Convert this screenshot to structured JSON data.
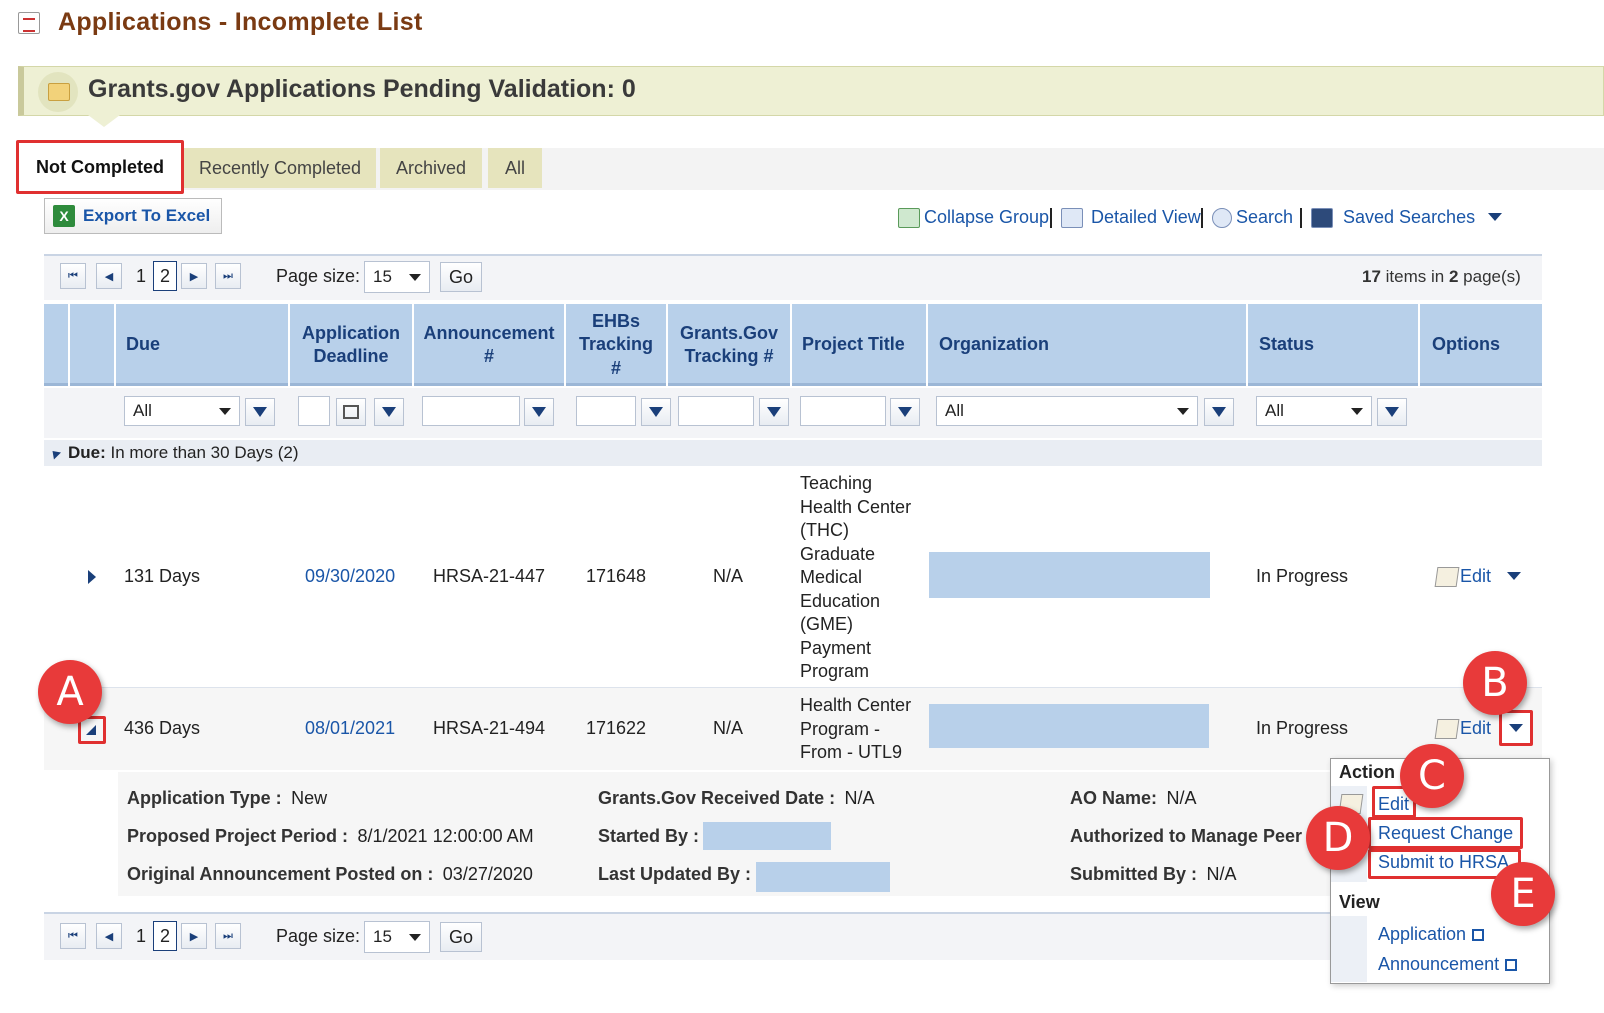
{
  "page": {
    "title": "Applications - Incomplete List",
    "banner": "Grants.gov Applications Pending Validation: 0"
  },
  "tabs": [
    {
      "label": "Not Completed",
      "active": true
    },
    {
      "label": "Recently Completed"
    },
    {
      "label": "Archived"
    },
    {
      "label": "All"
    }
  ],
  "toolbar": {
    "export": "Export To Excel",
    "collapse": "Collapse Group",
    "detailed": "Detailed View",
    "search": "Search",
    "saved": "Saved Searches"
  },
  "pager": {
    "page1": "1",
    "page2": "2",
    "page_size_label": "Page size:",
    "page_size": "15",
    "go": "Go",
    "items_count": "17",
    "items_text1": "items in",
    "pages_count": "2",
    "items_text2": "page(s)"
  },
  "columns": {
    "due": "Due",
    "deadline1": "Application",
    "deadline2": "Deadline",
    "announcement1": "Announcement",
    "announcement2": "#",
    "ehbs1": "EHBs",
    "ehbs2": "Tracking",
    "ehbs3": "#",
    "grants1": "Grants.Gov",
    "grants2": "Tracking #",
    "project": "Project Title",
    "organization": "Organization",
    "status": "Status",
    "options": "Options"
  },
  "filters": {
    "due": "All",
    "organization": "All",
    "status": "All"
  },
  "group": {
    "label": "Due:",
    "value": "In more than 30 Days (2)"
  },
  "rows": [
    {
      "due": "131 Days",
      "deadline": "09/30/2020",
      "announcement": "HRSA-21-447",
      "ehbs": "171648",
      "grants": "N/A",
      "project_lines": [
        "Teaching",
        "Health Center",
        "(THC)",
        "Graduate",
        "Medical",
        "Education",
        "(GME)",
        "Payment",
        "Program"
      ],
      "status": "In Progress",
      "edit": "Edit"
    },
    {
      "due": "436 Days",
      "deadline": "08/01/2021",
      "announcement": "HRSA-21-494",
      "ehbs": "171622",
      "grants": "N/A",
      "project_lines": [
        "Health Center",
        "Program -",
        "From - UTL9"
      ],
      "status": "In Progress",
      "edit": "Edit"
    }
  ],
  "detail": {
    "app_type_label": "Application Type :",
    "app_type": "New",
    "period_label": "Proposed Project Period :",
    "period": "8/1/2021 12:00:00 AM",
    "posted_label": "Original Announcement Posted on :",
    "posted": "03/27/2020",
    "received_label": "Grants.Gov Received Date :",
    "received": "N/A",
    "started_label": "Started By :",
    "updated_label": "Last Updated By :",
    "ao_label": "AO Name:",
    "ao": "N/A",
    "peer_label": "Authorized to Manage Peer A",
    "submitted_label": "Submitted By :",
    "submitted": "N/A"
  },
  "menu": {
    "action": "Action",
    "edit": "Edit",
    "request": "Request Change",
    "submit": "Submit to HRSA",
    "view": "View",
    "application": "Application",
    "announcement": "Announcement"
  },
  "callouts": {
    "a": "A",
    "b": "B",
    "c": "C",
    "d": "D",
    "e": "E"
  },
  "colors": {
    "accent": "#e03030",
    "header": "#b8d0ea",
    "link": "#1a56a8",
    "title": "#7a3a12"
  }
}
